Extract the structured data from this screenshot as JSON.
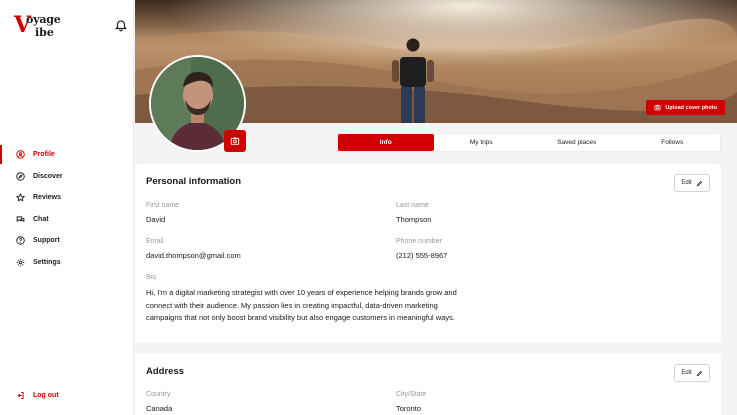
{
  "brand": {
    "logo_letter": "V",
    "logo_line1": "oyage",
    "logo_line2": "ibe",
    "accent": "#d10000"
  },
  "sidebar": {
    "items": [
      {
        "label": "Profile",
        "icon": "user-circle-icon",
        "active": true
      },
      {
        "label": "Discover",
        "icon": "compass-icon",
        "active": false
      },
      {
        "label": "Reviews",
        "icon": "star-icon",
        "active": false
      },
      {
        "label": "Chat",
        "icon": "chat-icon",
        "active": false
      },
      {
        "label": "Support",
        "icon": "help-icon",
        "active": false
      },
      {
        "label": "Settings",
        "icon": "gear-icon",
        "active": false
      }
    ],
    "logout_label": "Log out"
  },
  "cover": {
    "upload_label": "Upload cover photo"
  },
  "tabs": [
    {
      "label": "Info",
      "active": true
    },
    {
      "label": "My trips",
      "active": false
    },
    {
      "label": "Saved places",
      "active": false
    },
    {
      "label": "Follows",
      "active": false
    }
  ],
  "personal": {
    "title": "Personal information",
    "edit_label": "Edit",
    "first_name_label": "First name",
    "first_name": "David",
    "last_name_label": "Last name",
    "last_name": "Thompson",
    "email_label": "Email",
    "email": "david.thompson@gmail.com",
    "phone_label": "Phone number",
    "phone": "(212) 555-8967",
    "bio_label": "Bio",
    "bio": "Hi, I'm a digital marketing strategist with over 10 years of experience helping brands grow and connect with their audience. My passion lies in creating impactful, data-driven marketing campaigns that not only boost brand visibility but also engage customers in meaningful ways."
  },
  "address": {
    "title": "Address",
    "edit_label": "Edit",
    "country_label": "Country",
    "country": "Canada",
    "city_label": "City/State",
    "city": "Toronto"
  }
}
